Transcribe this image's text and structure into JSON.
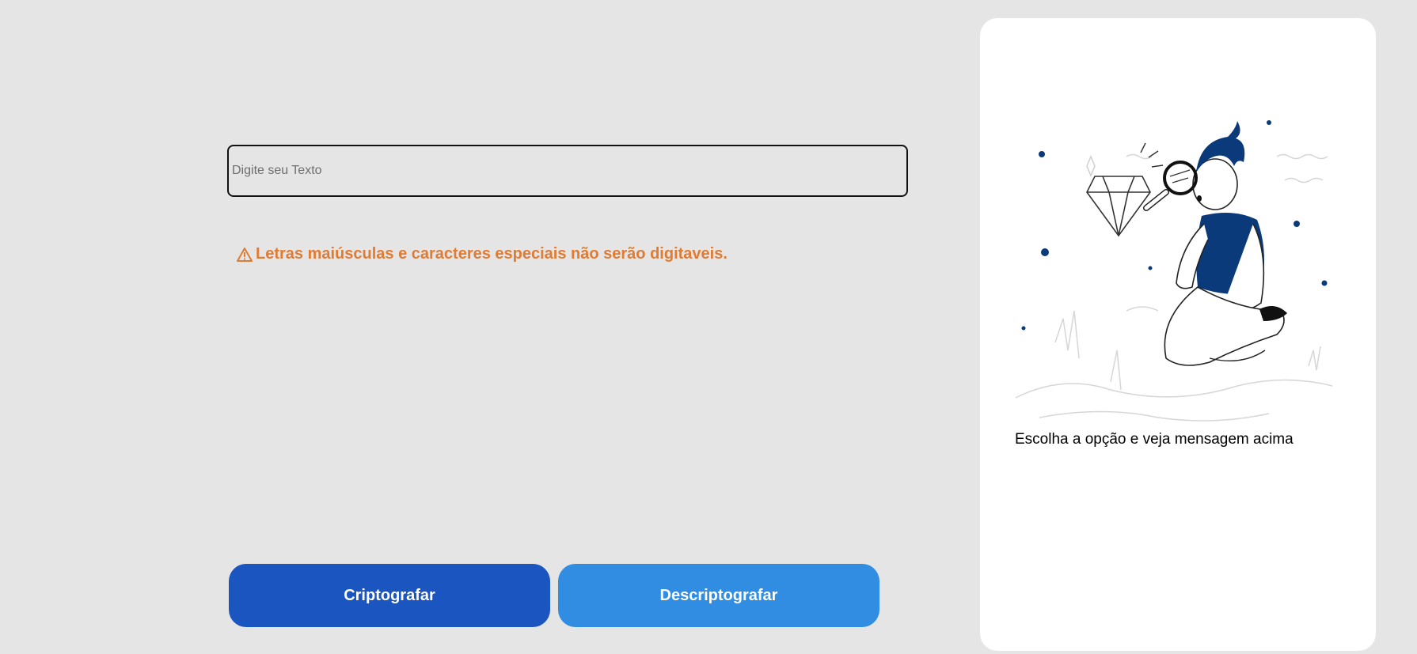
{
  "input": {
    "placeholder": "Digite seu Texto",
    "value": ""
  },
  "warning": {
    "icon": "warning-icon",
    "text": "Letras maiúsculas e caracteres especiais não serão digitaveis."
  },
  "buttons": {
    "encrypt_label": "Criptografar",
    "decrypt_label": "Descriptografar"
  },
  "output_card": {
    "illustration": "person-with-magnifying-glass-diamond-illustration",
    "message": "Escolha a opção e veja mensagem acima"
  },
  "colors": {
    "background": "#e5e5e5",
    "warning": "#e07b33",
    "encrypt_button": "#1a55c0",
    "decrypt_button": "#308de2",
    "illustration_accent": "#0b3a7a"
  }
}
